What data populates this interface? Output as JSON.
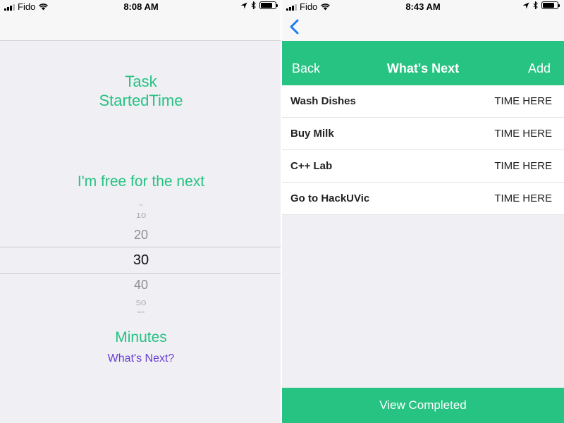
{
  "left": {
    "status": {
      "carrier": "Fido",
      "time": "8:08 AM"
    },
    "task_title_line1": "Task",
    "task_title_line2": "StartedTime",
    "free_label": "I'm free for the next",
    "picker": {
      "values": [
        "0",
        "10",
        "20",
        "30",
        "40",
        "50",
        "60"
      ],
      "selected": "30"
    },
    "minutes_label": "Minutes",
    "whats_next_link": "What's Next?"
  },
  "right": {
    "status": {
      "carrier": "Fido",
      "time": "8:43 AM"
    },
    "navbar": {
      "back": "Back",
      "title": "What's Next",
      "add": "Add"
    },
    "tasks": [
      {
        "name": "Wash Dishes",
        "time": "TIME HERE"
      },
      {
        "name": "Buy Milk",
        "time": "TIME HERE"
      },
      {
        "name": "C++ Lab",
        "time": "TIME HERE"
      },
      {
        "name": "Go to HackUVic",
        "time": "TIME HERE"
      }
    ],
    "view_completed": "View Completed"
  },
  "colors": {
    "accent_green": "#27c382",
    "link_purple": "#6a3fd4",
    "ios_blue": "#1a7cf5"
  }
}
